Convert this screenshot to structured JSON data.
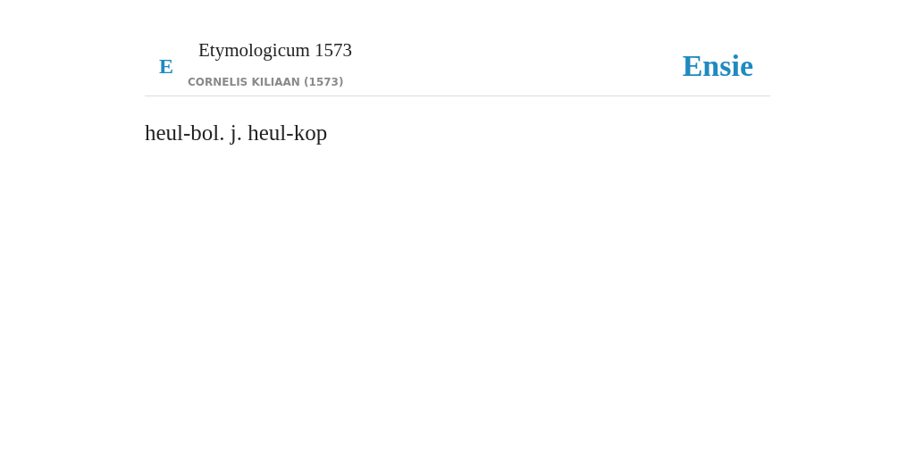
{
  "header": {
    "logo_letter": "E",
    "title": "Etymologicum 1573",
    "subtitle": "CORNELIS KILIAAN (1573)",
    "brand": "Ensie"
  },
  "entry": {
    "text": "heul-bol. j. heul-kop"
  }
}
